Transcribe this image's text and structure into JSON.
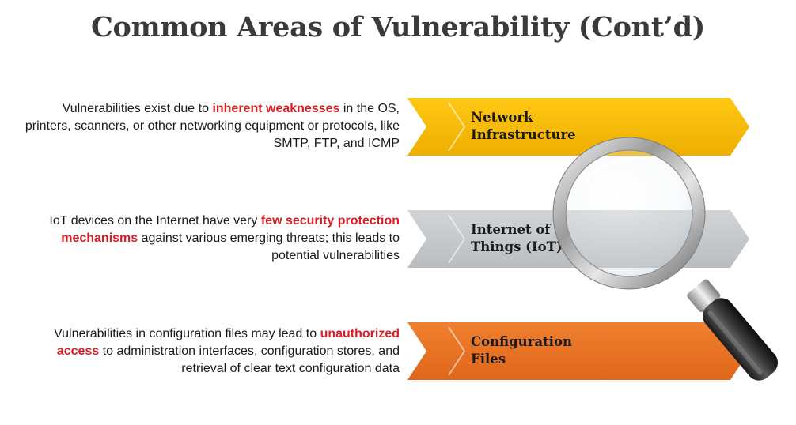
{
  "title": "Common Areas of Vulnerability (Cont’d)",
  "colors": {
    "highlight": "#d61f26",
    "banner_yellow": "#f5b800",
    "banner_gray": "#c8cbcd",
    "banner_orange": "#ea7424"
  },
  "items": [
    {
      "label_line1": "Network",
      "label_line2": "Infrastructure",
      "desc": [
        {
          "text": "Vulnerabilities exist due to "
        },
        {
          "text": "inherent weaknesses",
          "highlight": true
        },
        {
          "text": " in the OS, printers, scanners, or other networking equipment or protocols, like SMTP, FTP, and ICMP"
        }
      ]
    },
    {
      "label_line1": "Internet of",
      "label_line2": "Things (IoT)",
      "desc": [
        {
          "text": "IoT devices on the Internet have very "
        },
        {
          "text": "few security protection mechanisms",
          "highlight": true
        },
        {
          "text": " against various emerging threats; this leads to potential vulnerabilities"
        }
      ]
    },
    {
      "label_line1": "Configuration",
      "label_line2": "Files",
      "desc": [
        {
          "text": "Vulnerabilities in configuration files may lead to "
        },
        {
          "text": "unauthorized access",
          "highlight": true
        },
        {
          "text": " to administration interfaces, configuration stores, and retrieval of clear text configuration data"
        }
      ]
    }
  ],
  "icon": "magnifying-glass-icon"
}
